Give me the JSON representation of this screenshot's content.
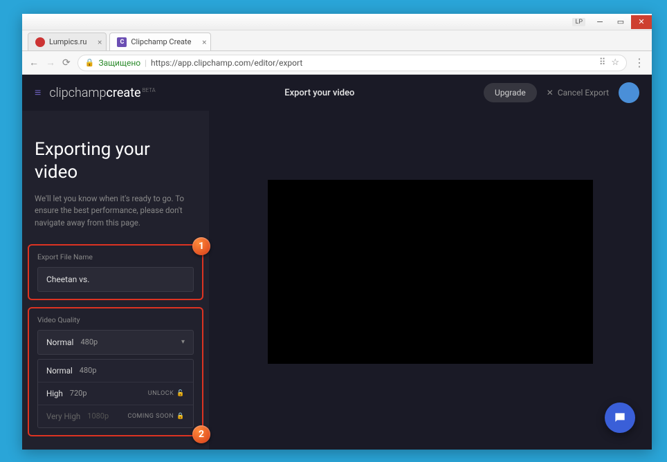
{
  "titlebar": {
    "badge": "LP"
  },
  "tabs": [
    {
      "label": "Lumpics.ru",
      "favicon_letter": ""
    },
    {
      "label": "Clipchamp Create",
      "favicon_letter": "C"
    }
  ],
  "addressbar": {
    "secure_label": "Защищено",
    "url": "https://app.clipchamp.com/editor/export"
  },
  "header": {
    "logo_main": "clipchamp",
    "logo_accent": "create",
    "logo_badge": "BETA",
    "title": "Export your video",
    "upgrade": "Upgrade",
    "cancel": "Cancel Export"
  },
  "sidebar": {
    "title": "Exporting your video",
    "desc": "We'll let you know when it's ready to go. To ensure the best performance, please don't navigate away from this page.",
    "filename_label": "Export File Name",
    "filename_value": "Cheetan vs.",
    "quality_label": "Video Quality",
    "selected": {
      "name": "Normal",
      "res": "480p"
    },
    "options": [
      {
        "name": "Normal",
        "res": "480p",
        "tag": ""
      },
      {
        "name": "High",
        "res": "720p",
        "tag": "UNLOCK"
      },
      {
        "name": "Very High",
        "res": "1080p",
        "tag": "COMING SOON"
      }
    ],
    "markers": {
      "one": "1",
      "two": "2"
    }
  }
}
